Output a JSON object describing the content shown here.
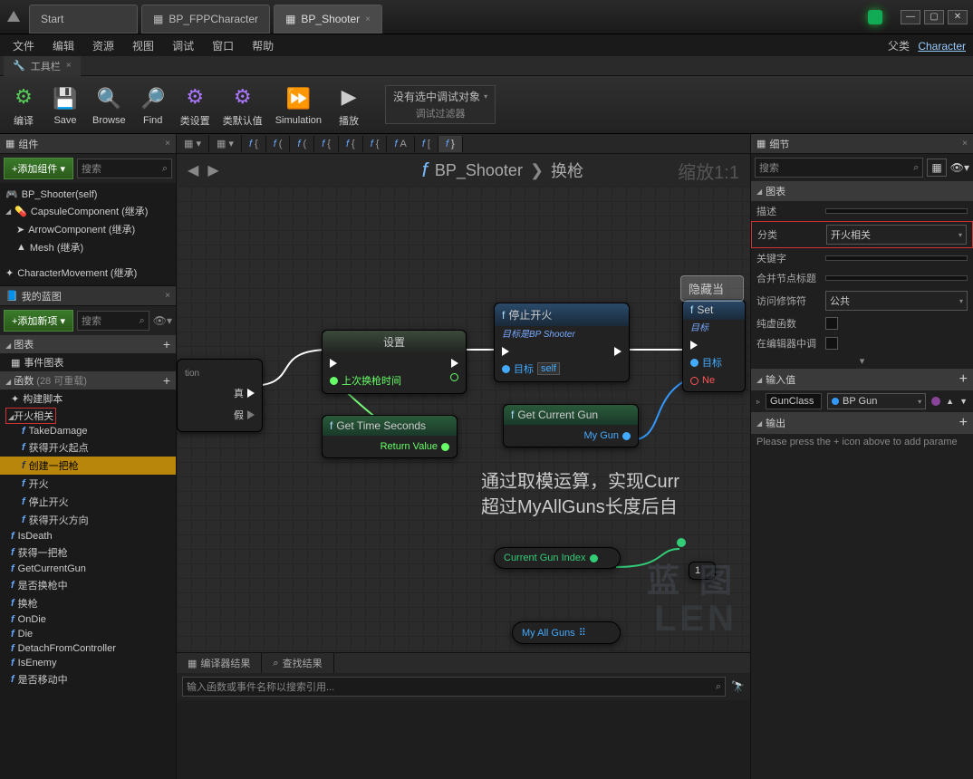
{
  "titlebar": {
    "tabs": [
      {
        "label": "Start",
        "active": false
      },
      {
        "label": "BP_FPPCharacter",
        "active": false
      },
      {
        "label": "BP_Shooter",
        "active": true
      }
    ]
  },
  "menubar": {
    "items": [
      "文件",
      "编辑",
      "资源",
      "视图",
      "调试",
      "窗口",
      "帮助"
    ],
    "parent_label": "父类",
    "parent_link": "Character"
  },
  "toolbar_tab": {
    "label": "工具栏"
  },
  "toolbar": {
    "compile": "编译",
    "save": "Save",
    "browse": "Browse",
    "find": "Find",
    "class_settings": "类设置",
    "class_defaults": "类默认值",
    "simulation": "Simulation",
    "play": "播放",
    "debug_none": "没有选中调试对象",
    "debug_filter": "调试过滤器"
  },
  "components": {
    "panel_title": "组件",
    "add_btn": "+添加组件",
    "search_placeholder": "搜索",
    "tree": [
      {
        "label": "BP_Shooter(self)",
        "indent": 0
      },
      {
        "label": "CapsuleComponent (继承)",
        "indent": 0,
        "caret": true
      },
      {
        "label": "ArrowComponent (继承)",
        "indent": 1
      },
      {
        "label": "Mesh (继承)",
        "indent": 1
      },
      {
        "label": "CharacterMovement (继承)",
        "indent": 0
      }
    ]
  },
  "myblueprint": {
    "panel_title": "我的蓝图",
    "add_btn": "+添加新项",
    "search_placeholder": "搜索",
    "section_graph": "图表",
    "event_graph": "事件图表",
    "section_functions": "函数",
    "functions_count": "(28 可重载)",
    "construction_script": "构建脚本",
    "fire_group": "开火相关",
    "functions": [
      "TakeDamage",
      "获得开火起点",
      "创建一把枪",
      "开火",
      "停止开火",
      "获得开火方向",
      "IsDeath",
      "获得一把枪",
      "GetCurrentGun",
      "是否换枪中",
      "换枪",
      "OnDie",
      "Die",
      "DetachFromController",
      "IsEnemy",
      "是否移动中"
    ],
    "selected_function": "创建一把枪"
  },
  "graph": {
    "breadcrumb": {
      "asset": "BP_Shooter",
      "func": "换枪"
    },
    "zoom": "缩放1:1",
    "tabs": [
      "",
      "",
      "f  {",
      "f  (",
      "f  (",
      "f  {",
      "f  {",
      "f  {",
      "f  A",
      "f  [",
      "f  }"
    ],
    "nodes": {
      "branch": {
        "true_label": "真",
        "false_label": "假",
        "tail": "tion"
      },
      "set": {
        "title": "设置",
        "pin_lastswap": "上次换枪时间"
      },
      "stopfire": {
        "title": "停止开火",
        "subtitle": "目标是BP Shooter",
        "target": "目标",
        "self": "self"
      },
      "setvar": {
        "title": "Set",
        "subtitle": "目标",
        "new_label": "Ne"
      },
      "gettime": {
        "title": "Get Time Seconds",
        "return": "Return Value"
      },
      "getcurrent": {
        "title": "Get Current Gun",
        "return": "My Gun"
      },
      "curindex": "Current Gun Index",
      "myallguns": "My All Guns",
      "comment_hide": "隐藏当",
      "comment_text1": "通过取模运算，实现Curr",
      "comment_text2": "超过MyAllGuns长度后自",
      "one_node": "1"
    },
    "watermark": "LEN",
    "watermark2": "蓝 图"
  },
  "bottom": {
    "compiler_results": "编译器结果",
    "find_results": "查找结果",
    "search_placeholder": "输入函数或事件名称以搜索引用..."
  },
  "details": {
    "panel_title": "细节",
    "search_placeholder": "搜索",
    "section_graph": "图表",
    "desc_label": "描述",
    "category_label": "分类",
    "category_value": "开火相关",
    "keywords_label": "关键字",
    "merge_label": "合并节点标题",
    "access_label": "访问修饰符",
    "access_value": "公共",
    "pure_label": "纯虚函数",
    "editor_label": "在编辑器中调",
    "section_inputs": "输入值",
    "input_name": "GunClass",
    "input_type": "BP Gun",
    "section_outputs": "输出",
    "outputs_hint": "Please press the + icon above to add parame"
  }
}
